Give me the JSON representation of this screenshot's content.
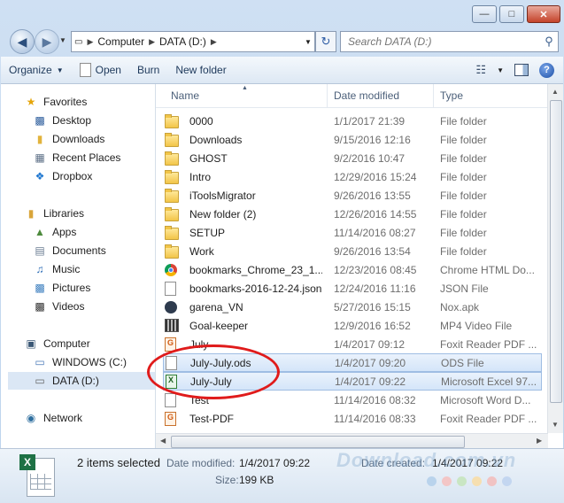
{
  "address": {
    "segments": [
      "Computer",
      "DATA (D:)"
    ]
  },
  "search": {
    "placeholder": "Search DATA (D:)"
  },
  "toolbar": {
    "organize": "Organize",
    "open": "Open",
    "burn": "Burn",
    "new_folder": "New folder"
  },
  "nav": {
    "favorites": "Favorites",
    "fav_items": [
      "Desktop",
      "Downloads",
      "Recent Places",
      "Dropbox"
    ],
    "libraries": "Libraries",
    "lib_items": [
      "Apps",
      "Documents",
      "Music",
      "Pictures",
      "Videos"
    ],
    "computer": "Computer",
    "computer_items": [
      "WINDOWS (C:)",
      "DATA (D:)"
    ],
    "network": "Network"
  },
  "columns": {
    "name": "Name",
    "date": "Date modified",
    "type": "Type"
  },
  "files": [
    {
      "name": "0000",
      "date": "1/1/2017 21:39",
      "type": "File folder",
      "icon": "folder-icon"
    },
    {
      "name": "Downloads",
      "date": "9/15/2016 12:16",
      "type": "File folder",
      "icon": "folder-icon"
    },
    {
      "name": "GHOST",
      "date": "9/2/2016 10:47",
      "type": "File folder",
      "icon": "folder-icon"
    },
    {
      "name": "Intro",
      "date": "12/29/2016 15:24",
      "type": "File folder",
      "icon": "folder-icon"
    },
    {
      "name": "iToolsMigrator",
      "date": "9/26/2016 13:55",
      "type": "File folder",
      "icon": "folder-icon"
    },
    {
      "name": "New folder (2)",
      "date": "12/26/2016 14:55",
      "type": "File folder",
      "icon": "folder-icon"
    },
    {
      "name": "SETUP",
      "date": "11/14/2016 08:27",
      "type": "File folder",
      "icon": "folder-icon"
    },
    {
      "name": "Work",
      "date": "9/26/2016 13:54",
      "type": "File folder",
      "icon": "folder-icon"
    },
    {
      "name": "bookmarks_Chrome_23_1...",
      "date": "12/23/2016 08:45",
      "type": "Chrome HTML Do...",
      "icon": "chrome-icon"
    },
    {
      "name": "bookmarks-2016-12-24.json",
      "date": "12/24/2016 11:16",
      "type": "JSON File",
      "icon": "document-icon"
    },
    {
      "name": "garena_VN",
      "date": "5/27/2016 15:15",
      "type": "Nox.apk",
      "icon": "apk-icon"
    },
    {
      "name": "Goal-keeper",
      "date": "12/9/2016 16:52",
      "type": "MP4 Video File",
      "icon": "video-icon"
    },
    {
      "name": "July",
      "date": "1/4/2017 09:12",
      "type": "Foxit Reader PDF ...",
      "icon": "pdf-icon"
    },
    {
      "name": "July-July.ods",
      "date": "1/4/2017 09:20",
      "type": "ODS File",
      "icon": "document-icon",
      "selected": true
    },
    {
      "name": "July-July",
      "date": "1/4/2017 09:22",
      "type": "Microsoft Excel 97...",
      "icon": "excel-icon",
      "selected": true
    },
    {
      "name": "Test",
      "date": "11/14/2016 08:32",
      "type": "Microsoft Word D...",
      "icon": "document-icon"
    },
    {
      "name": "Test-PDF",
      "date": "11/14/2016 08:33",
      "type": "Foxit Reader PDF ...",
      "icon": "pdf-icon"
    }
  ],
  "details": {
    "selection": "2 items selected",
    "date_modified_label": "Date modified:",
    "date_modified": "1/4/2017 09:22",
    "date_created_label": "Date created:",
    "date_created": "1/4/2017 09:22",
    "size_label": "Size:",
    "size": "199 KB"
  },
  "watermark": "Download.com.vn",
  "colors": {
    "accent": "#e01b1b",
    "selection": "#d4e5f9"
  }
}
